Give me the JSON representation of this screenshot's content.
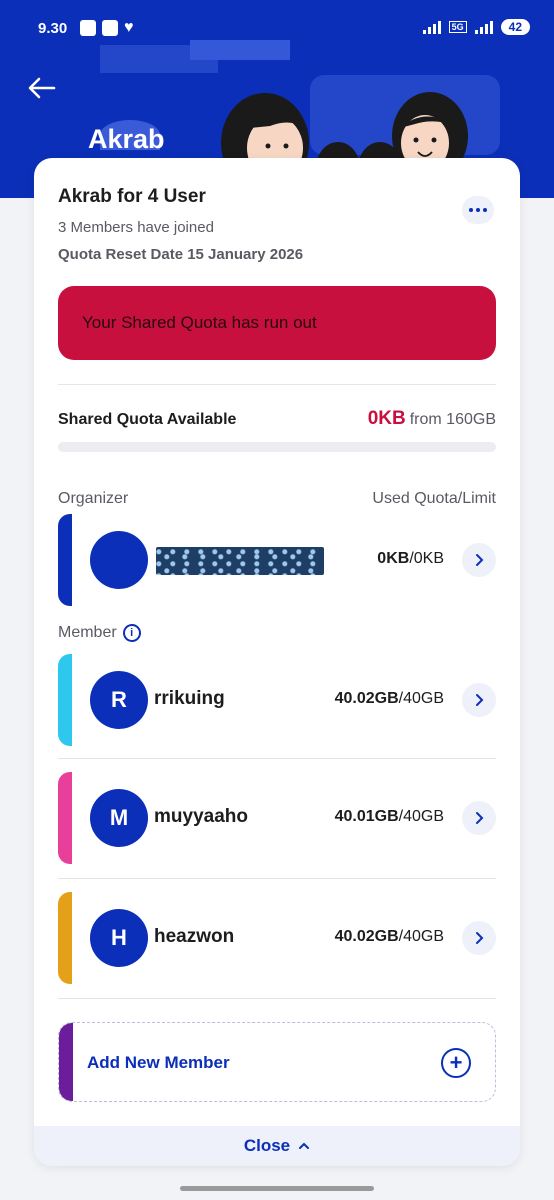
{
  "status_bar": {
    "time": "9.30",
    "network": "5G",
    "battery": "42"
  },
  "header": {
    "title": "Akrab"
  },
  "plan": {
    "name": "Akrab for 4 User",
    "members_joined": "3 Members have joined",
    "reset_date": "Quota Reset Date 15 January 2026"
  },
  "alert": {
    "message": "Your Shared Quota has run out"
  },
  "shared_quota": {
    "label": "Shared Quota Available",
    "available": "0KB",
    "total": "from 160GB",
    "fill_fraction": 0
  },
  "organizer_section": {
    "label": "Organizer",
    "column_label": "Used Quota/Limit"
  },
  "organizer": {
    "used": "0KB",
    "limit": "/0KB",
    "stripe_color": "#0b2fb8"
  },
  "member_section": {
    "label": "Member"
  },
  "members": [
    {
      "initial": "R",
      "name": "rrikuing",
      "used": "40.02GB",
      "limit": "/40GB",
      "stripe_color": "#2ec8ef"
    },
    {
      "initial": "M",
      "name": "muyyaaho",
      "used": "40.01GB",
      "limit": "/40GB",
      "stripe_color": "#e73f9a"
    },
    {
      "initial": "H",
      "name": "heazwon",
      "used": "40.02GB",
      "limit": "/40GB",
      "stripe_color": "#e5a019"
    }
  ],
  "add_member": {
    "label": "Add New Member"
  },
  "footer": {
    "close_label": "Close"
  },
  "colors": {
    "brand": "#0b2fb8",
    "alert": "#c8103f",
    "add_stripe": "#6c1d9c"
  }
}
